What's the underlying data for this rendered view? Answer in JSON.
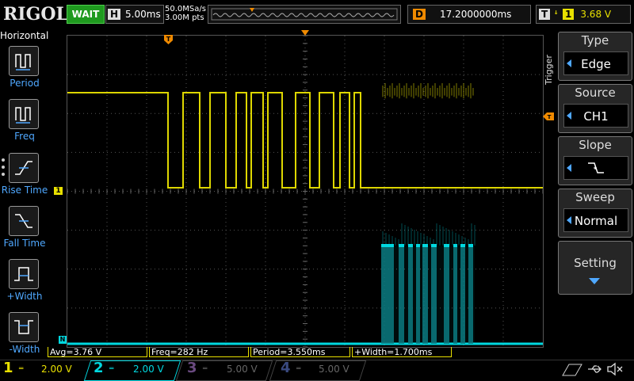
{
  "top": {
    "logo": "RIGOL",
    "run_state": "WAIT",
    "timebase_tag": "H",
    "timebase": "5.00ms",
    "sample_rate": "50.0MSa/s",
    "mem_depth": "3.00M pts",
    "delay_tag": "D",
    "delay": "17.2000000ms",
    "trigger_tag": "T",
    "trigger_channel": "1",
    "trigger_level": "3.68 V"
  },
  "left_menu": {
    "title": "Horizontal",
    "items": [
      {
        "label": "Period",
        "icon": "period-icon"
      },
      {
        "label": "Freq",
        "icon": "freq-icon"
      },
      {
        "label": "Rise Time",
        "icon": "rise-time-icon"
      },
      {
        "label": "Fall Time",
        "icon": "fall-time-icon"
      },
      {
        "label": "+Width",
        "icon": "pos-width-icon"
      },
      {
        "label": "-Width",
        "icon": "neg-width-icon"
      }
    ]
  },
  "right_menu": {
    "vertical_title": "Trigger",
    "type": {
      "title": "Type",
      "value": "Edge"
    },
    "source": {
      "title": "Source",
      "value": "CH1"
    },
    "slope": {
      "title": "Slope",
      "icon": "falling-edge-icon"
    },
    "sweep": {
      "title": "Sweep",
      "value": "Normal"
    },
    "setting": {
      "title": "Setting"
    }
  },
  "markers": {
    "ch1_marker": "1",
    "ch2_marker": "N"
  },
  "measurements": [
    "Avg=3.76 V",
    "Freq=282 Hz",
    "Period=3.550ms",
    "+Width=1.700ms"
  ],
  "channels": [
    {
      "num": "1",
      "scale": "2.00 V",
      "color": "#e8e000",
      "active": true
    },
    {
      "num": "2",
      "scale": "2.00 V",
      "color": "#00d8e0",
      "active": true
    },
    {
      "num": "3",
      "scale": "5.00 V",
      "color": "#b070d0",
      "active": false
    },
    {
      "num": "4",
      "scale": "5.00 V",
      "color": "#4a6ad8",
      "active": false
    }
  ],
  "colors": {
    "ch1": "#e8e000",
    "ch2": "#00d8e0",
    "accent": "#4fa8ff",
    "trigger": "#f08a00"
  }
}
